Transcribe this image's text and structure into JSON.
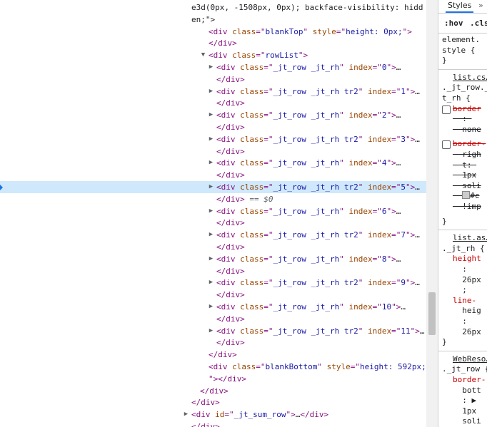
{
  "elements_panel": {
    "lines": [
      {
        "indent": 268,
        "tri": "",
        "parts": [
          {
            "t": "plain",
            "v": "e3d(0px, -1508px, 0px); backface-visibility: hidd"
          }
        ]
      },
      {
        "indent": 268,
        "tri": "",
        "parts": [
          {
            "t": "plain",
            "v": "en;\">"
          }
        ]
      },
      {
        "indent": 292,
        "tri": "",
        "parts": [
          {
            "t": "tag",
            "v": "<div "
          },
          {
            "t": "attr-name",
            "v": "class"
          },
          {
            "t": "tag",
            "v": "=\""
          },
          {
            "t": "attr-value",
            "v": "blankTop"
          },
          {
            "t": "tag",
            "v": "\" "
          },
          {
            "t": "attr-name",
            "v": "style"
          },
          {
            "t": "tag",
            "v": "=\""
          },
          {
            "t": "attr-value",
            "v": "height: 0px;"
          },
          {
            "t": "tag",
            "v": "\">"
          }
        ]
      },
      {
        "indent": 292,
        "tri": "",
        "parts": [
          {
            "t": "tag",
            "v": "</div>"
          }
        ]
      },
      {
        "indent": 292,
        "tri": "▼",
        "parts": [
          {
            "t": "tag",
            "v": "<div "
          },
          {
            "t": "attr-name",
            "v": "class"
          },
          {
            "t": "tag",
            "v": "=\""
          },
          {
            "t": "attr-value",
            "v": "rowList"
          },
          {
            "t": "tag",
            "v": "\">"
          }
        ]
      },
      {
        "indent": 303,
        "tri": "▶",
        "parts": [
          {
            "t": "tag",
            "v": "<div "
          },
          {
            "t": "attr-name",
            "v": "class"
          },
          {
            "t": "tag",
            "v": "=\""
          },
          {
            "t": "attr-value",
            "v": "_jt_row _jt_rh"
          },
          {
            "t": "tag",
            "v": "\" "
          },
          {
            "t": "attr-name",
            "v": "index"
          },
          {
            "t": "tag",
            "v": "=\""
          },
          {
            "t": "attr-value",
            "v": "0"
          },
          {
            "t": "tag",
            "v": "\">"
          },
          {
            "t": "plain",
            "v": "…"
          }
        ]
      },
      {
        "indent": 303,
        "tri": "",
        "parts": [
          {
            "t": "tag",
            "v": "</div>"
          }
        ]
      },
      {
        "indent": 303,
        "tri": "▶",
        "parts": [
          {
            "t": "tag",
            "v": "<div "
          },
          {
            "t": "attr-name",
            "v": "class"
          },
          {
            "t": "tag",
            "v": "=\""
          },
          {
            "t": "attr-value",
            "v": "_jt_row _jt_rh tr2"
          },
          {
            "t": "tag",
            "v": "\" "
          },
          {
            "t": "attr-name",
            "v": "index"
          },
          {
            "t": "tag",
            "v": "=\""
          },
          {
            "t": "attr-value",
            "v": "1"
          },
          {
            "t": "tag",
            "v": "\">"
          },
          {
            "t": "plain",
            "v": "…"
          }
        ]
      },
      {
        "indent": 303,
        "tri": "",
        "parts": [
          {
            "t": "tag",
            "v": "</div>"
          }
        ]
      },
      {
        "indent": 303,
        "tri": "▶",
        "parts": [
          {
            "t": "tag",
            "v": "<div "
          },
          {
            "t": "attr-name",
            "v": "class"
          },
          {
            "t": "tag",
            "v": "=\""
          },
          {
            "t": "attr-value",
            "v": "_jt_row _jt_rh"
          },
          {
            "t": "tag",
            "v": "\" "
          },
          {
            "t": "attr-name",
            "v": "index"
          },
          {
            "t": "tag",
            "v": "=\""
          },
          {
            "t": "attr-value",
            "v": "2"
          },
          {
            "t": "tag",
            "v": "\">"
          },
          {
            "t": "plain",
            "v": "…"
          }
        ]
      },
      {
        "indent": 303,
        "tri": "",
        "parts": [
          {
            "t": "tag",
            "v": "</div>"
          }
        ]
      },
      {
        "indent": 303,
        "tri": "▶",
        "parts": [
          {
            "t": "tag",
            "v": "<div "
          },
          {
            "t": "attr-name",
            "v": "class"
          },
          {
            "t": "tag",
            "v": "=\""
          },
          {
            "t": "attr-value",
            "v": "_jt_row _jt_rh tr2"
          },
          {
            "t": "tag",
            "v": "\" "
          },
          {
            "t": "attr-name",
            "v": "index"
          },
          {
            "t": "tag",
            "v": "=\""
          },
          {
            "t": "attr-value",
            "v": "3"
          },
          {
            "t": "tag",
            "v": "\">"
          },
          {
            "t": "plain",
            "v": "…"
          }
        ]
      },
      {
        "indent": 303,
        "tri": "",
        "parts": [
          {
            "t": "tag",
            "v": "</div>"
          }
        ]
      },
      {
        "indent": 303,
        "tri": "▶",
        "parts": [
          {
            "t": "tag",
            "v": "<div "
          },
          {
            "t": "attr-name",
            "v": "class"
          },
          {
            "t": "tag",
            "v": "=\""
          },
          {
            "t": "attr-value",
            "v": "_jt_row _jt_rh"
          },
          {
            "t": "tag",
            "v": "\" "
          },
          {
            "t": "attr-name",
            "v": "index"
          },
          {
            "t": "tag",
            "v": "=\""
          },
          {
            "t": "attr-value",
            "v": "4"
          },
          {
            "t": "tag",
            "v": "\">"
          },
          {
            "t": "plain",
            "v": "…"
          }
        ]
      },
      {
        "indent": 303,
        "tri": "",
        "parts": [
          {
            "t": "tag",
            "v": "</div>"
          }
        ]
      },
      {
        "indent": 303,
        "tri": "▶",
        "selected": true,
        "parts": [
          {
            "t": "tag",
            "v": "<div "
          },
          {
            "t": "attr-name",
            "v": "class"
          },
          {
            "t": "tag",
            "v": "=\""
          },
          {
            "t": "attr-value",
            "v": "_jt_row _jt_rh tr2"
          },
          {
            "t": "tag",
            "v": "\" "
          },
          {
            "t": "attr-name",
            "v": "index"
          },
          {
            "t": "tag",
            "v": "=\""
          },
          {
            "t": "attr-value",
            "v": "5"
          },
          {
            "t": "tag",
            "v": "\">"
          },
          {
            "t": "plain",
            "v": "…"
          }
        ]
      },
      {
        "indent": 303,
        "tri": "",
        "parts": [
          {
            "t": "tag",
            "v": "</div>"
          },
          {
            "t": "sel-marker",
            "v": " == $0"
          }
        ]
      },
      {
        "indent": 303,
        "tri": "▶",
        "parts": [
          {
            "t": "tag",
            "v": "<div "
          },
          {
            "t": "attr-name",
            "v": "class"
          },
          {
            "t": "tag",
            "v": "=\""
          },
          {
            "t": "attr-value",
            "v": "_jt_row _jt_rh"
          },
          {
            "t": "tag",
            "v": "\" "
          },
          {
            "t": "attr-name",
            "v": "index"
          },
          {
            "t": "tag",
            "v": "=\""
          },
          {
            "t": "attr-value",
            "v": "6"
          },
          {
            "t": "tag",
            "v": "\">"
          },
          {
            "t": "plain",
            "v": "…"
          }
        ]
      },
      {
        "indent": 303,
        "tri": "",
        "parts": [
          {
            "t": "tag",
            "v": "</div>"
          }
        ]
      },
      {
        "indent": 303,
        "tri": "▶",
        "parts": [
          {
            "t": "tag",
            "v": "<div "
          },
          {
            "t": "attr-name",
            "v": "class"
          },
          {
            "t": "tag",
            "v": "=\""
          },
          {
            "t": "attr-value",
            "v": "_jt_row _jt_rh tr2"
          },
          {
            "t": "tag",
            "v": "\" "
          },
          {
            "t": "attr-name",
            "v": "index"
          },
          {
            "t": "tag",
            "v": "=\""
          },
          {
            "t": "attr-value",
            "v": "7"
          },
          {
            "t": "tag",
            "v": "\">"
          },
          {
            "t": "plain",
            "v": "…"
          }
        ]
      },
      {
        "indent": 303,
        "tri": "",
        "parts": [
          {
            "t": "tag",
            "v": "</div>"
          }
        ]
      },
      {
        "indent": 303,
        "tri": "▶",
        "parts": [
          {
            "t": "tag",
            "v": "<div "
          },
          {
            "t": "attr-name",
            "v": "class"
          },
          {
            "t": "tag",
            "v": "=\""
          },
          {
            "t": "attr-value",
            "v": "_jt_row _jt_rh"
          },
          {
            "t": "tag",
            "v": "\" "
          },
          {
            "t": "attr-name",
            "v": "index"
          },
          {
            "t": "tag",
            "v": "=\""
          },
          {
            "t": "attr-value",
            "v": "8"
          },
          {
            "t": "tag",
            "v": "\">"
          },
          {
            "t": "plain",
            "v": "…"
          }
        ]
      },
      {
        "indent": 303,
        "tri": "",
        "parts": [
          {
            "t": "tag",
            "v": "</div>"
          }
        ]
      },
      {
        "indent": 303,
        "tri": "▶",
        "parts": [
          {
            "t": "tag",
            "v": "<div "
          },
          {
            "t": "attr-name",
            "v": "class"
          },
          {
            "t": "tag",
            "v": "=\""
          },
          {
            "t": "attr-value",
            "v": "_jt_row _jt_rh tr2"
          },
          {
            "t": "tag",
            "v": "\" "
          },
          {
            "t": "attr-name",
            "v": "index"
          },
          {
            "t": "tag",
            "v": "=\""
          },
          {
            "t": "attr-value",
            "v": "9"
          },
          {
            "t": "tag",
            "v": "\">"
          },
          {
            "t": "plain",
            "v": "…"
          }
        ]
      },
      {
        "indent": 303,
        "tri": "",
        "parts": [
          {
            "t": "tag",
            "v": "</div>"
          }
        ]
      },
      {
        "indent": 303,
        "tri": "▶",
        "parts": [
          {
            "t": "tag",
            "v": "<div "
          },
          {
            "t": "attr-name",
            "v": "class"
          },
          {
            "t": "tag",
            "v": "=\""
          },
          {
            "t": "attr-value",
            "v": "_jt_row _jt_rh"
          },
          {
            "t": "tag",
            "v": "\" "
          },
          {
            "t": "attr-name",
            "v": "index"
          },
          {
            "t": "tag",
            "v": "=\""
          },
          {
            "t": "attr-value",
            "v": "10"
          },
          {
            "t": "tag",
            "v": "\">"
          },
          {
            "t": "plain",
            "v": "…"
          }
        ]
      },
      {
        "indent": 303,
        "tri": "",
        "parts": [
          {
            "t": "tag",
            "v": "</div>"
          }
        ]
      },
      {
        "indent": 303,
        "tri": "▶",
        "parts": [
          {
            "t": "tag",
            "v": "<div "
          },
          {
            "t": "attr-name",
            "v": "class"
          },
          {
            "t": "tag",
            "v": "=\""
          },
          {
            "t": "attr-value",
            "v": "_jt_row _jt_rh tr2"
          },
          {
            "t": "tag",
            "v": "\" "
          },
          {
            "t": "attr-name",
            "v": "index"
          },
          {
            "t": "tag",
            "v": "=\""
          },
          {
            "t": "attr-value",
            "v": "11"
          },
          {
            "t": "tag",
            "v": "\">"
          },
          {
            "t": "plain",
            "v": "…"
          }
        ]
      },
      {
        "indent": 303,
        "tri": "",
        "parts": [
          {
            "t": "tag",
            "v": "</div>"
          }
        ]
      },
      {
        "indent": 292,
        "tri": "",
        "parts": [
          {
            "t": "tag",
            "v": "</div>"
          }
        ]
      },
      {
        "indent": 292,
        "tri": "",
        "parts": [
          {
            "t": "tag",
            "v": "<div "
          },
          {
            "t": "attr-name",
            "v": "class"
          },
          {
            "t": "tag",
            "v": "=\""
          },
          {
            "t": "attr-value",
            "v": "blankBottom"
          },
          {
            "t": "tag",
            "v": "\" "
          },
          {
            "t": "attr-name",
            "v": "style"
          },
          {
            "t": "tag",
            "v": "=\""
          },
          {
            "t": "attr-value",
            "v": "height: 592px;"
          }
        ]
      },
      {
        "indent": 292,
        "tri": "",
        "parts": [
          {
            "t": "tag",
            "v": "\"></div>"
          }
        ]
      },
      {
        "indent": 280,
        "tri": "",
        "parts": [
          {
            "t": "tag",
            "v": "</div>"
          }
        ]
      },
      {
        "indent": 268,
        "tri": "",
        "parts": [
          {
            "t": "tag",
            "v": "</div>"
          }
        ]
      },
      {
        "indent": 268,
        "tri": "▶",
        "parts": [
          {
            "t": "tag",
            "v": "<div "
          },
          {
            "t": "attr-name",
            "v": "id"
          },
          {
            "t": "tag",
            "v": "=\""
          },
          {
            "t": "attr-value",
            "v": "_jt_sum_row"
          },
          {
            "t": "tag",
            "v": "\">"
          },
          {
            "t": "plain",
            "v": "…"
          },
          {
            "t": "tag",
            "v": "</div>"
          }
        ]
      },
      {
        "indent": 268,
        "tri": "",
        "parts": [
          {
            "t": "tag",
            "v": "</div>"
          }
        ]
      }
    ]
  },
  "styles_pane": {
    "tab_label": "Styles",
    "more_tabs": "»",
    "hov_label": ":hov",
    "cls_label": ".cls",
    "element_style": [
      "element.",
      "style {",
      "}"
    ],
    "rule1": {
      "source": "list.cs…",
      "selector": [
        "._jt_row._",
        "t_rh {"
      ],
      "decls": [
        {
          "lines": [
            "border",
            "  : ",
            "  none"
          ],
          "strike": true,
          "checkbox": true
        },
        {
          "lines": [
            "border-",
            "  righ",
            "  t: ",
            "  1px",
            "  soli",
            "  #c",
            "  !imp"
          ],
          "strike": true,
          "checkbox": true
        }
      ],
      "close": "}"
    },
    "rule2": {
      "source": "list.as…",
      "selector": [
        "._jt_rh {"
      ],
      "decls": [
        {
          "lines": [
            "height",
            "  :",
            "  26px",
            "  ;"
          ]
        },
        {
          "lines": [
            "line-",
            "  heig",
            "  :",
            "  26px"
          ]
        }
      ],
      "close": "}"
    },
    "rule3": {
      "source": "WebReso…",
      "selector": [
        "._jt_row {"
      ],
      "decls": [
        {
          "lines": [
            "border-",
            "  bott",
            "  : ▶",
            "  1px",
            "  soli"
          ]
        }
      ]
    }
  }
}
